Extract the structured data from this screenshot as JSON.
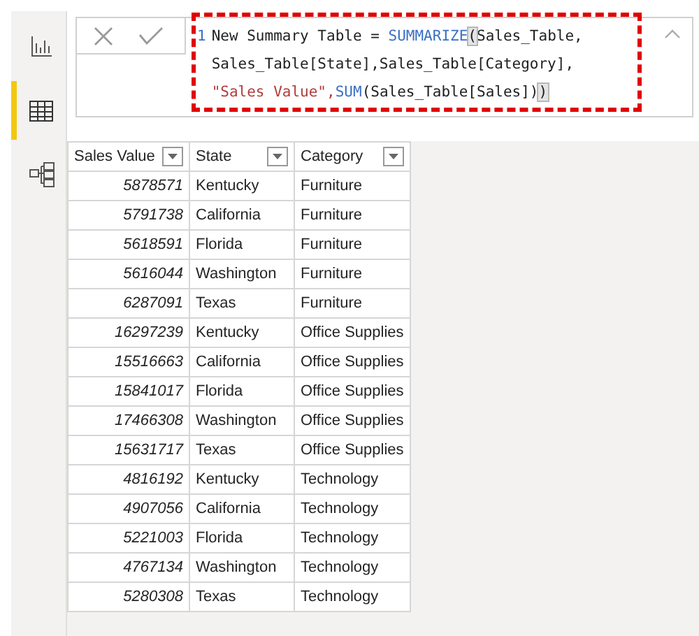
{
  "sidebar": {
    "items": [
      {
        "kind": "report",
        "selected": false
      },
      {
        "kind": "data",
        "selected": true
      },
      {
        "kind": "model",
        "selected": false
      }
    ]
  },
  "formula_bar": {
    "line_number": "1",
    "lines": [
      [
        {
          "text": "New Summary Table = ",
          "kind": "plain"
        },
        {
          "text": "SUMMARIZE",
          "kind": "function"
        },
        {
          "text": "(",
          "kind": "bracket"
        },
        {
          "text": "Sales_Table,",
          "kind": "plain"
        }
      ],
      [
        {
          "text": "Sales_Table[State],Sales_Table[Category],",
          "kind": "plain"
        }
      ],
      [
        {
          "text": "\"Sales Value\",",
          "kind": "string"
        },
        {
          "text": "SUM",
          "kind": "function"
        },
        {
          "text": "(Sales_Table[Sales])",
          "kind": "plain"
        },
        {
          "text": ")",
          "kind": "bracket"
        }
      ]
    ]
  },
  "table": {
    "columns": [
      "Sales Value",
      "State",
      "Category"
    ],
    "rows": [
      [
        "5878571",
        "Kentucky",
        "Furniture"
      ],
      [
        "5791738",
        "California",
        "Furniture"
      ],
      [
        "5618591",
        "Florida",
        "Furniture"
      ],
      [
        "5616044",
        "Washington",
        "Furniture"
      ],
      [
        "6287091",
        "Texas",
        "Furniture"
      ],
      [
        "16297239",
        "Kentucky",
        "Office Supplies"
      ],
      [
        "15516663",
        "California",
        "Office Supplies"
      ],
      [
        "15841017",
        "Florida",
        "Office Supplies"
      ],
      [
        "17466308",
        "Washington",
        "Office Supplies"
      ],
      [
        "15631717",
        "Texas",
        "Office Supplies"
      ],
      [
        "4816192",
        "Kentucky",
        "Technology"
      ],
      [
        "4907056",
        "California",
        "Technology"
      ],
      [
        "5221003",
        "Florida",
        "Technology"
      ],
      [
        "4767134",
        "Washington",
        "Technology"
      ],
      [
        "5280308",
        "Texas",
        "Technology"
      ]
    ]
  }
}
